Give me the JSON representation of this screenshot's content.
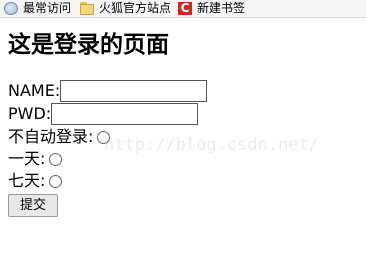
{
  "bookmarks": [
    {
      "label": "最常访问",
      "icon": "globe-icon"
    },
    {
      "label": "火狐官方站点",
      "icon": "folder-icon"
    },
    {
      "label": "新建书签",
      "icon": "csdn-logo-icon",
      "glyph": "C"
    }
  ],
  "page": {
    "title": "这是登录的页面"
  },
  "form": {
    "name_label": "NAME:",
    "name_value": "",
    "pwd_label": "PWD:",
    "pwd_value": "",
    "options": [
      {
        "label": "不自动登录:"
      },
      {
        "label": "一天:"
      },
      {
        "label": "七天:"
      }
    ],
    "submit_label": "提交"
  },
  "watermark": "http://blog.csdn.net/"
}
